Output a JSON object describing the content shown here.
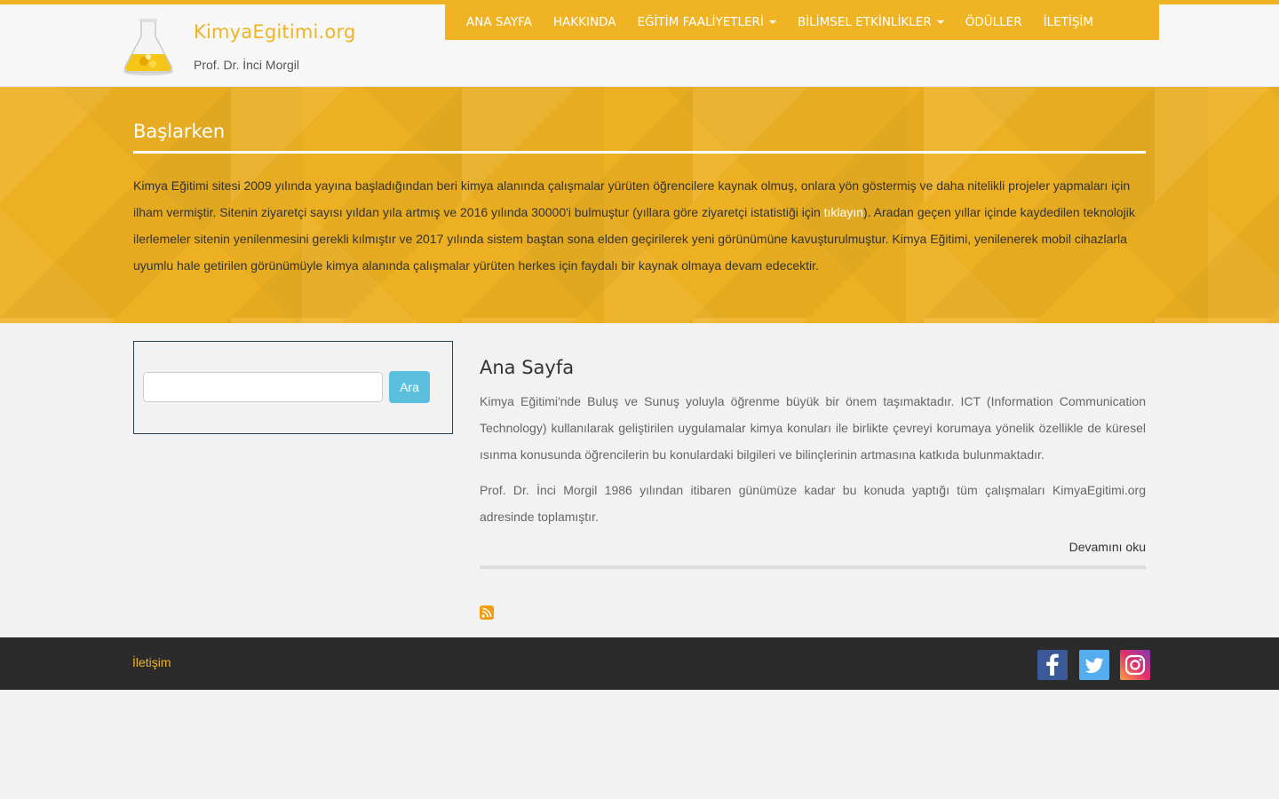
{
  "header": {
    "site_title": "KimyaEgitimi.org",
    "site_subtitle": "Prof. Dr. İnci Morgil",
    "nav": [
      {
        "label": "ANA SAYFA",
        "dropdown": false
      },
      {
        "label": "HAKKINDA",
        "dropdown": false
      },
      {
        "label": "EĞİTİM FAALİYETLERİ",
        "dropdown": true
      },
      {
        "label": "BİLİMSEL ETKİNLİKLER",
        "dropdown": true
      },
      {
        "label": "ÖDÜLLER",
        "dropdown": false
      },
      {
        "label": "İLETİŞİM",
        "dropdown": false
      }
    ]
  },
  "hero": {
    "title": "Başlarken",
    "text_before_link": "Kimya Eğitimi sitesi 2009 yılında yayına başladığından beri kimya alanında çalışmalar yürüten öğrencilere kaynak olmuş, onlara yön göstermiş ve daha nitelikli projeler yapmaları için ilham vermiştir. Sitenin ziyaretçi sayısı yıldan yıla artmış ve 2016 yılında 30000'i bulmuştur (yıllara göre ziyaretçi istatistiği için ",
    "link_text": "tıklayın",
    "text_after_link": "). Aradan geçen yıllar içinde kaydedilen teknolojik ilerlemeler sitenin yenilenmesini gerekli kılmıştır ve 2017 yılında sistem baştan sona elden geçirilerek yeni görünümüne kavuşturulmuştur. Kimya Eğitimi, yenilenerek mobil cihazlarla uyumlu hale getirilen görünümüyle kimya alanında çalışmalar yürüten herkes için faydalı bir kaynak olmaya devam edecektir."
  },
  "search": {
    "value": "",
    "placeholder": "",
    "button_label": "Ara"
  },
  "main": {
    "title": "Ana Sayfa",
    "paragraph1": "Kimya Eğitimi'nde Buluş ve Sunuş yoluyla öğrenme büyük bir önem taşımaktadır. ICT (Information Communication Technology) kullanılarak geliştirilen uygulamalar kimya konuları ile birlikte çevreyi korumaya yönelik özellikle de küresel ısınma konusunda öğrencilerin bu konulardaki bilgileri ve bilinçlerinin artmasına katkıda bulunmaktadır.",
    "paragraph2": "Prof. Dr. İnci Morgil 1986 yılından itibaren günümüze kadar bu konuda yaptığı tüm çalışmaları KimyaEgitimi.org adresinde toplamıştır.",
    "read_more": "Devamını oku"
  },
  "footer": {
    "contact_link": "İletişim",
    "social_icons": [
      "facebook-icon",
      "twitter-icon",
      "instagram-icon"
    ]
  },
  "colors": {
    "accent": "#f0b323",
    "search_button": "#5bc0de",
    "footer_bg": "#2b2b2b"
  }
}
